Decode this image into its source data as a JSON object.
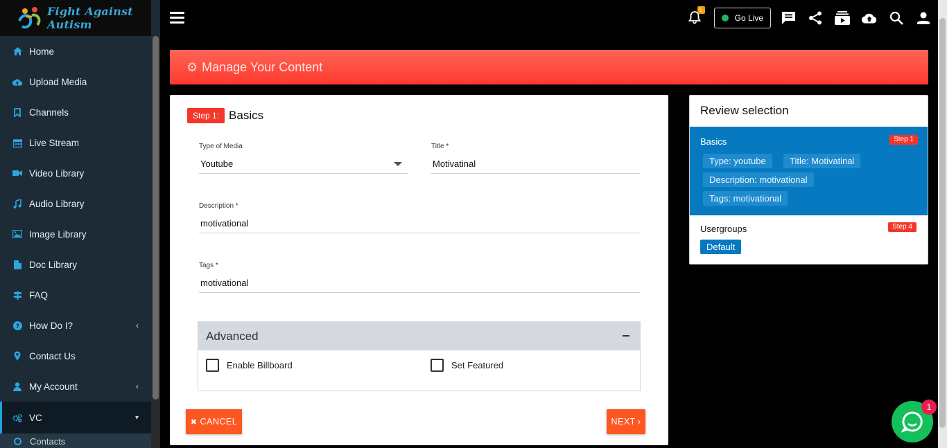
{
  "brand": {
    "logo_text": "Fight Against Autism"
  },
  "sidebar": {
    "items": [
      {
        "label": "Home",
        "icon": "home-icon"
      },
      {
        "label": "Upload Media",
        "icon": "cloud-upload-icon"
      },
      {
        "label": "Channels",
        "icon": "bookmark-icon"
      },
      {
        "label": "Live Stream",
        "icon": "calendar-icon"
      },
      {
        "label": "Video Library",
        "icon": "video-camera-icon"
      },
      {
        "label": "Audio Library",
        "icon": "music-note-icon"
      },
      {
        "label": "Image Library",
        "icon": "image-icon"
      },
      {
        "label": "Doc Library",
        "icon": "document-icon"
      },
      {
        "label": "FAQ",
        "icon": "signpost-icon"
      },
      {
        "label": "How Do I?",
        "icon": "question-circle-icon"
      },
      {
        "label": "Contact Us",
        "icon": "map-pin-icon"
      },
      {
        "label": "My Account",
        "icon": "user-icon"
      },
      {
        "label": "VC",
        "icon": "cogs-icon"
      }
    ],
    "sub_items": [
      {
        "label": "Contacts"
      }
    ]
  },
  "topbar": {
    "notification_count": "5",
    "go_live_label": "Go Live",
    "icons": [
      "bell-icon",
      "chat-icon",
      "share-icon",
      "playlist-icon",
      "cloud-upload-icon",
      "search-icon",
      "user-icon"
    ]
  },
  "banner": {
    "title": "Manage Your Content"
  },
  "form": {
    "step_badge": "Step 1:",
    "step_name": "Basics",
    "type_label": "Type of Media",
    "type_value": "Youtube",
    "title_label": "Title *",
    "title_value": "Motivatinal",
    "description_label": "Description *",
    "description_value": "motivational",
    "tags_label": "Tags *",
    "tags_value": "motivational",
    "advanced_title": "Advanced",
    "enable_billboard_label": "Enable Billboard",
    "set_featured_label": "Set Featured",
    "cancel_label": "CANCEL",
    "next_label": "NEXT"
  },
  "review": {
    "title": "Review selection",
    "basics_label": "Basics",
    "basics_step": "Step 1",
    "chips": {
      "type": "Type: youtube",
      "title": "Title: Motivatinal",
      "description": "Description: motivational",
      "tags": "Tags: motivational"
    },
    "usergroups_label": "Usergroups",
    "usergroups_step": "Step 4",
    "default_chip": "Default"
  },
  "chat": {
    "unread": "1"
  },
  "colors": {
    "accent_red": "#ff3a2f",
    "brand_blue": "#0779c0",
    "button_orange": "#ff5722",
    "live_green": "#1fb65a"
  }
}
